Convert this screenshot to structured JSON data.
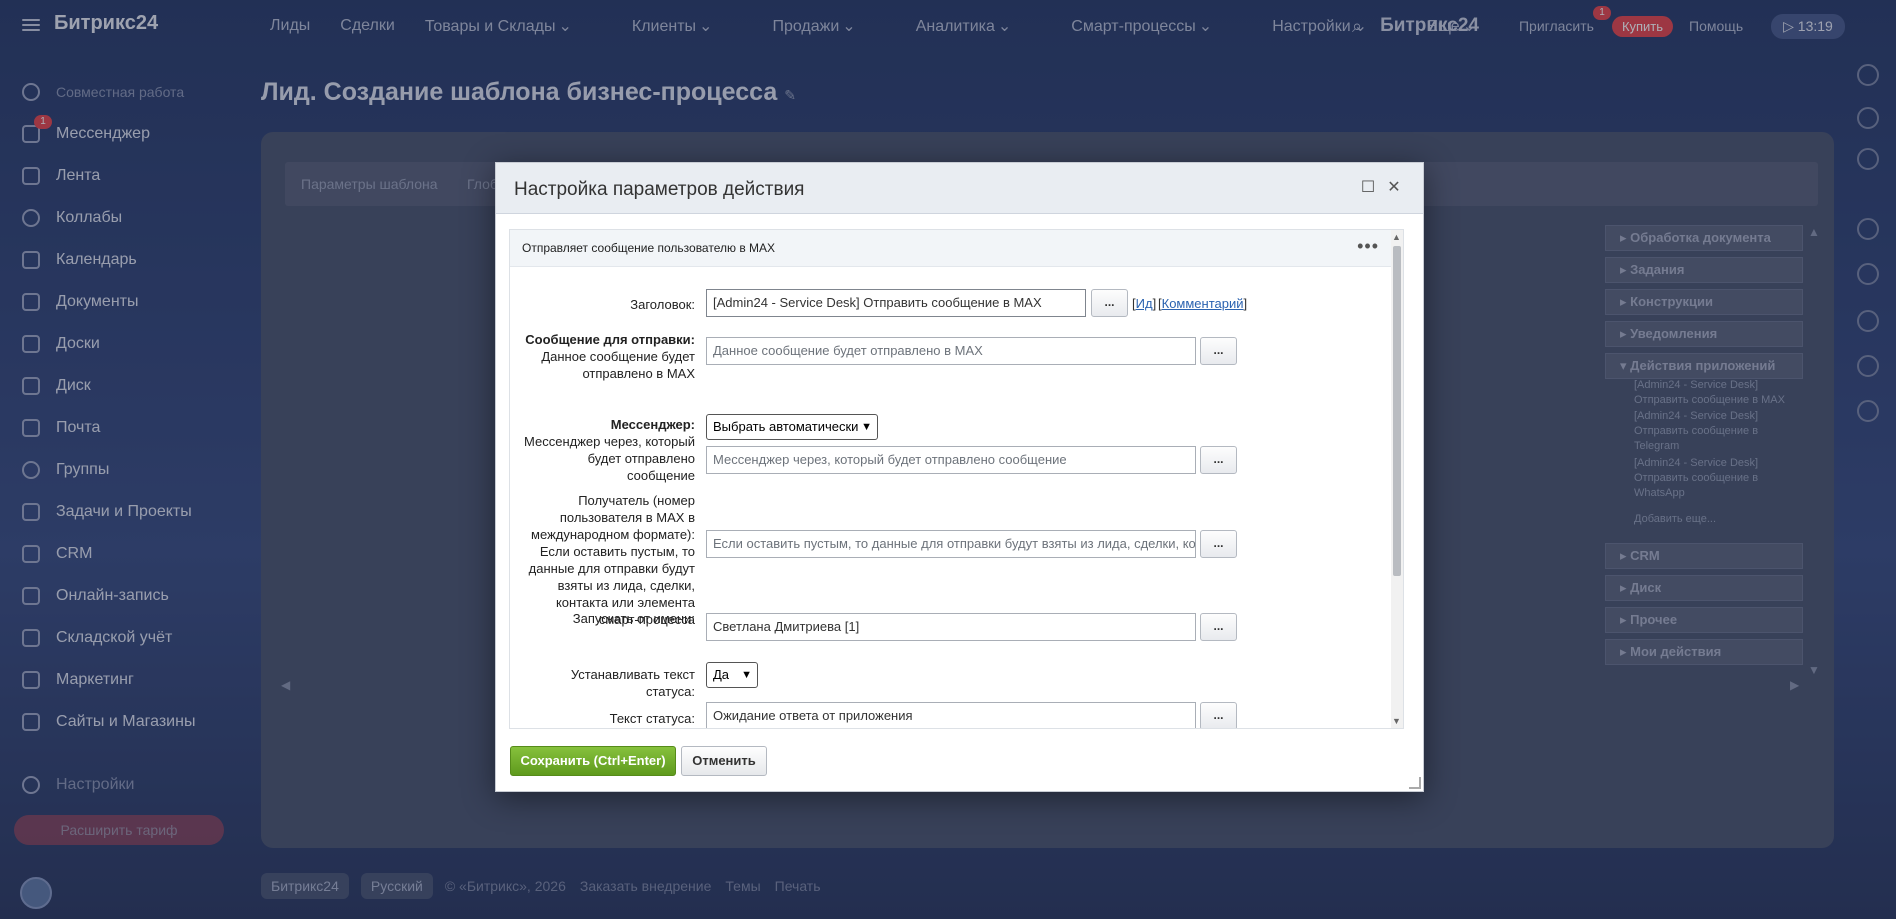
{
  "topbar": {
    "logo": "Битрикс24",
    "nav": [
      "Лиды",
      "Сделки",
      "Товары и Склады",
      "Клиенты",
      "Продажи",
      "Аналитика",
      "Смарт-процессы",
      "Настройки",
      "Еще"
    ],
    "brand": "Битрикс24",
    "invite": "Пригласить",
    "invite_badge": "1",
    "buy": "Купить",
    "help": "Помощь",
    "time": "13:19"
  },
  "sidebar": {
    "group": "Совместная работа",
    "items": [
      "Мессенджер",
      "Лента",
      "Коллабы",
      "Календарь",
      "Документы",
      "Доски",
      "Диск",
      "Почта",
      "Группы",
      "Задачи и Проекты",
      "CRM",
      "Онлайн-запись",
      "Складской учёт",
      "Маркетинг",
      "Сайты и Магазины"
    ],
    "messenger_badge": "1",
    "settings": "Настройки",
    "tariff": "Расширить тариф"
  },
  "page": {
    "title": "Лид. Создание шаблона бизнес-процесса",
    "tabs": [
      "Параметры шаблона",
      "Глоб"
    ]
  },
  "right_panel": {
    "sections": [
      "Обработка документа",
      "Задания",
      "Конструкции",
      "Уведомления",
      "Действия приложений",
      "CRM",
      "Диск",
      "Прочее",
      "Мои действия"
    ],
    "app_actions": [
      "[Admin24 - Service Desk] Отправить сообщение в MAX",
      "[Admin24 - Service Desk] Отправить сообщение в Telegram",
      "[Admin24 - Service Desk] Отправить сообщение в WhatsApp"
    ],
    "add_more": "Добавить еще..."
  },
  "footer": {
    "brand": "Битрикс24",
    "lang": "Русский",
    "copy": "© «Битрикс», 2026",
    "order": "Заказать внедрение",
    "themes": "Темы",
    "print": "Печать"
  },
  "dialog": {
    "title": "Настройка параметров действия",
    "description": "Отправляет сообщение пользователю в MAX",
    "fields": {
      "header_label": "Заголовок:",
      "header_value": "[Admin24 - Service Desk] Отправить сообщение в MAX",
      "id_link": "Ид",
      "comment_link": "Комментарий",
      "message_label_bold": "Сообщение для отправки:",
      "message_label_desc": "Данное сообщение будет отправлено в MAX",
      "message_placeholder": "Данное сообщение будет отправлено в MAX",
      "messenger_label_bold": "Мессенджер:",
      "messenger_label_desc": "Мессенджер через, который будет отправлено сообщение",
      "messenger_select": "Выбрать автоматически",
      "messenger_placeholder": "Мессенджер через, который будет отправлено сообщение",
      "recipient_label": "Получатель (номер пользователя в MAX в международном формате): Если оставить пустым, то данные для отправки будут взяты из лида, сделки, контакта или элемента смарт-процесса",
      "recipient_placeholder": "Если оставить пустым, то данные для отправки будут взяты из лида, сделки, контакта или",
      "run_as_label": "Запускать от имени:",
      "run_as_value": "Светлана Дмитриева [1]",
      "set_status_label": "Устанавливать текст статуса:",
      "set_status_value": "Да",
      "status_text_label": "Текст статуса:",
      "status_text_value": "Ожидание ответа от приложения"
    },
    "dots_label": "...",
    "save": "Сохранить (Ctrl+Enter)",
    "cancel": "Отменить"
  }
}
